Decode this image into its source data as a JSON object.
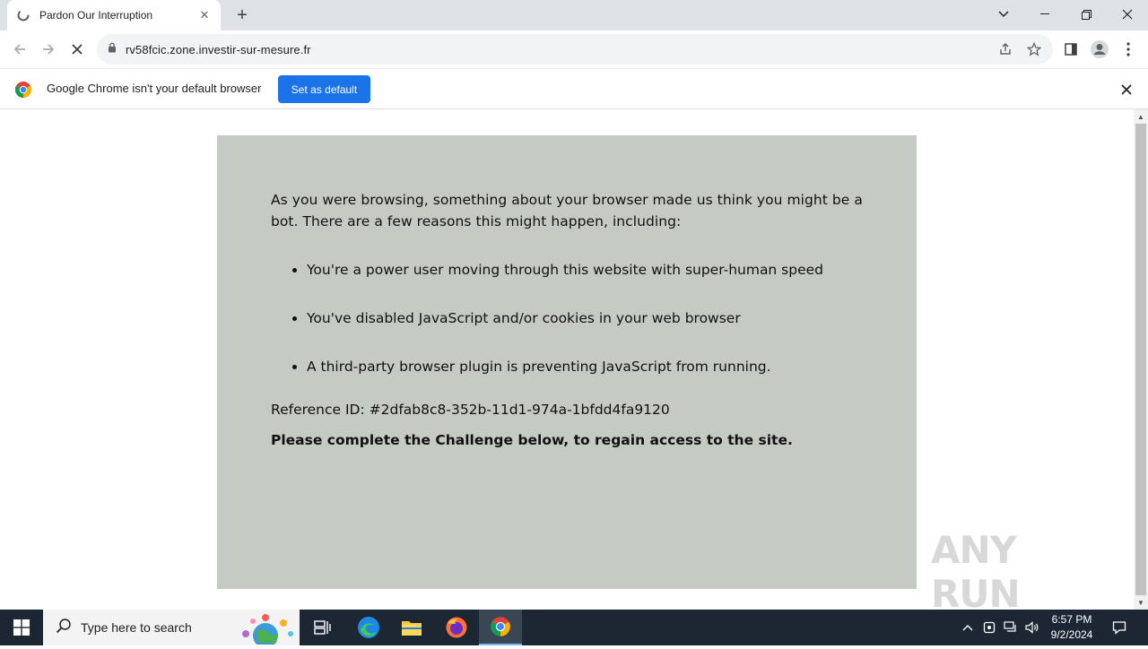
{
  "browser": {
    "tab_title": "Pardon Our Interruption",
    "url": "rv58fcic.zone.investir-sur-mesure.fr"
  },
  "infobar": {
    "message": "Google Chrome isn't your default browser",
    "button_label": "Set as default"
  },
  "page": {
    "intro": "As you were browsing, something about your browser made us think you might be a bot. There are a few reasons this might happen, including:",
    "reasons": [
      "You're a power user moving through this website with super-human speed",
      "You've disabled JavaScript and/or cookies in your web browser",
      "A third-party browser plugin is preventing JavaScript from running."
    ],
    "reference": "Reference ID: #2dfab8c8-352b-11d1-974a-1bfdd4fa9120",
    "challenge": "Please complete the Challenge below, to regain access to the site.",
    "card_color": "#c5cac2"
  },
  "watermark": {
    "text": "ANY RUN"
  },
  "taskbar": {
    "search_placeholder": "Type here to search",
    "time": "6:57 PM",
    "date": "9/2/2024",
    "apps": [
      "task-view-icon",
      "edge-icon",
      "file-explorer-icon",
      "firefox-icon",
      "chrome-icon"
    ]
  },
  "colors": {
    "accent": "#1a73e8",
    "taskbar": "#1c2733",
    "tabstrip": "#dee1e6"
  }
}
